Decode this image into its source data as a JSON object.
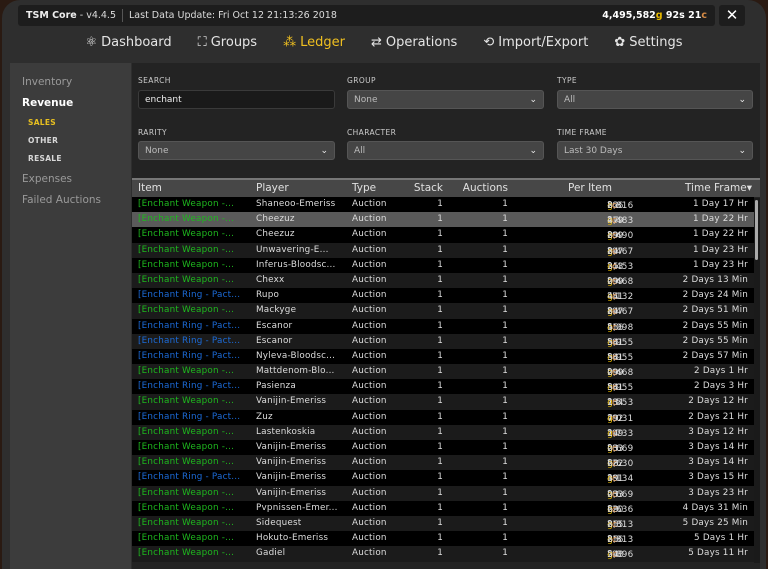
{
  "titlebar": {
    "app": "TSM Core",
    "version": "- v4.4.5",
    "last_update": "Last Data Update: Fri Oct 12 21:13:26 2018",
    "gold": "4,495,582",
    "silver": "92",
    "copper": "21"
  },
  "nav": [
    {
      "label": "Dashboard",
      "icon": "dashboard-icon",
      "glyph": "⚛"
    },
    {
      "label": "Groups",
      "icon": "groups-icon",
      "glyph": "⛶"
    },
    {
      "label": "Ledger",
      "icon": "ledger-icon",
      "glyph": "⁂",
      "active": true
    },
    {
      "label": "Operations",
      "icon": "operations-icon",
      "glyph": "⇄"
    },
    {
      "label": "Import/Export",
      "icon": "import-export-icon",
      "glyph": "⟲"
    },
    {
      "label": "Settings",
      "icon": "settings-icon",
      "glyph": "✿"
    }
  ],
  "sidebar": {
    "inventory": "Inventory",
    "revenue": "Revenue",
    "sales": "SALES",
    "other": "OTHER",
    "resale": "RESALE",
    "expenses": "Expenses",
    "failed": "Failed Auctions"
  },
  "filters": {
    "search_label": "SEARCH",
    "search_value": "enchant",
    "group_label": "GROUP",
    "group_value": "None",
    "type_label": "TYPE",
    "type_value": "All",
    "rarity_label": "RARITY",
    "rarity_value": "None",
    "character_label": "CHARACTER",
    "character_value": "All",
    "timeframe_label": "TIME FRAME",
    "timeframe_value": "Last 30 Days"
  },
  "colors": {
    "weapon_item": "#1eb81e",
    "ring_item": "#1c6bd8",
    "gold": "#e6b800",
    "copper": "#d58a45",
    "active": "#f0c020"
  },
  "table": {
    "headers": {
      "item": "Item",
      "player": "Player",
      "type": "Type",
      "stack": "Stack",
      "auctions": "Auctions",
      "per_item": "Per Item",
      "time_frame": "Time Frame▾"
    },
    "item_names": {
      "w": "[Enchant Weapon -...",
      "r": "[Enchant Ring - Pact..."
    },
    "selected_row": 1,
    "rows": [
      [
        "w",
        "Shaneoo-Emeriss",
        "Auction",
        "1",
        "1",
        "2,816",
        "82",
        "66",
        "1 Day 17 Hr"
      ],
      [
        "w",
        "Cheezuz",
        "Auction",
        "1",
        "1",
        "2,483",
        "47",
        "19",
        "1 Day 22 Hr"
      ],
      [
        "w",
        "Cheezuz",
        "Auction",
        "1",
        "1",
        "2,490",
        "89",
        "99",
        "1 Day 22 Hr"
      ],
      [
        "w",
        "Unwavering-E...",
        "Auction",
        "1",
        "1",
        "2,467",
        "84",
        "97",
        "1 Day 23 Hr"
      ],
      [
        "w",
        "Inferus-Bloodsc...",
        "Auction",
        "1",
        "1",
        "2,453",
        "35",
        "43",
        "1 Day 23 Hr"
      ],
      [
        "w",
        "Chexx",
        "Auction",
        "1",
        "1",
        "2,468",
        "09",
        "99",
        "2 Days 13 Min"
      ],
      [
        "r",
        "Rupo",
        "Auction",
        "1",
        "1",
        "4,132",
        "44",
        "51",
        "2 Days 24 Min"
      ],
      [
        "w",
        "Mackyge",
        "Auction",
        "1",
        "1",
        "2,467",
        "84",
        "97",
        "2 Days 51 Min"
      ],
      [
        "r",
        "Escanor",
        "Auction",
        "1",
        "1",
        "4,098",
        "55",
        "16",
        "2 Days 55 Min"
      ],
      [
        "r",
        "Escanor",
        "Auction",
        "1",
        "1",
        "3,955",
        "54",
        "81",
        "2 Days 55 Min"
      ],
      [
        "r",
        "Nyleva-Bloodsc...",
        "Auction",
        "1",
        "1",
        "3,955",
        "54",
        "81",
        "2 Days 57 Min"
      ],
      [
        "w",
        "Mattdenom-Blo...",
        "Auction",
        "1",
        "1",
        "2,468",
        "09",
        "99",
        "2 Days 1 Hr"
      ],
      [
        "r",
        "Pasienza",
        "Auction",
        "1",
        "1",
        "3,955",
        "54",
        "81",
        "2 Days 3 Hr"
      ],
      [
        "w",
        "Vanijin-Emeriss",
        "Auction",
        "1",
        "1",
        "2,553",
        "13",
        "84",
        "2 Days 12 Hr"
      ],
      [
        "r",
        "Zuz",
        "Auction",
        "1",
        "1",
        "4,031",
        "79",
        "92",
        "2 Days 21 Hr"
      ],
      [
        "w",
        "Lastenkoskia",
        "Auction",
        "1",
        "1",
        "2,733",
        "14",
        "99",
        "3 Days 12 Hr"
      ],
      [
        "w",
        "Vanijin-Emeriss",
        "Auction",
        "1",
        "1",
        "2,669",
        "03",
        "83",
        "3 Days 14 Hr"
      ],
      [
        "w",
        "Vanijin-Emeriss",
        "Auction",
        "1",
        "1",
        "2,630",
        "68",
        "22",
        "3 Days 14 Hr"
      ],
      [
        "r",
        "Vanijin-Emeriss",
        "Auction",
        "1",
        "1",
        "4,134",
        "39",
        "81",
        "3 Days 15 Hr"
      ],
      [
        "w",
        "Vanijin-Emeriss",
        "Auction",
        "1",
        "1",
        "2,669",
        "03",
        "83",
        "3 Days 23 Hr"
      ],
      [
        "w",
        "Pvpnissen-Emer...",
        "Auction",
        "1",
        "1",
        "2,636",
        "69",
        "20",
        "4 Days 31 Min"
      ],
      [
        "w",
        "Sidequest",
        "Auction",
        "1",
        "1",
        "2,813",
        "85",
        "15",
        "5 Days 25 Min"
      ],
      [
        "w",
        "Hokuto-Emeriss",
        "Auction",
        "1",
        "1",
        "2,813",
        "85",
        "16",
        "5 Days 1 Hr"
      ],
      [
        "w",
        "Gadiel",
        "Auction",
        "1",
        "1",
        "2,896",
        "54",
        "98",
        "5 Days 11 Hr"
      ]
    ]
  }
}
